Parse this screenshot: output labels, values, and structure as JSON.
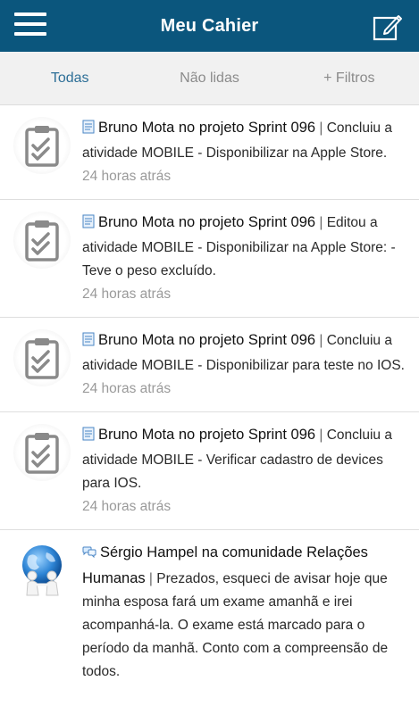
{
  "header": {
    "title": "Meu Cahier",
    "menu_icon": "hamburger-menu-icon",
    "compose_icon": "compose-edit-icon",
    "background": "#0b567d"
  },
  "tabs": [
    {
      "label": "Todas",
      "active": true
    },
    {
      "label": "Não lidas",
      "active": false
    },
    {
      "label": "+ Filtros",
      "active": false
    }
  ],
  "feed": [
    {
      "type_icon": "document-icon",
      "avatar": "clipboard-check-icon",
      "title": "Bruno Mota no projeto Sprint 096",
      "text": "Concluiu a atividade MOBILE - Disponibilizar na Apple Store.",
      "time": "24 horas atrás"
    },
    {
      "type_icon": "document-icon",
      "avatar": "clipboard-check-icon",
      "title": "Bruno Mota no projeto Sprint 096",
      "text": "Editou a atividade MOBILE - Disponibilizar na Apple Store: - Teve o peso excluído.",
      "time": "24 horas atrás"
    },
    {
      "type_icon": "document-icon",
      "avatar": "clipboard-check-icon",
      "title": "Bruno Mota no projeto Sprint 096",
      "text": "Concluiu a atividade MOBILE - Disponibilizar para teste no IOS.",
      "time": "24 horas atrás"
    },
    {
      "type_icon": "document-icon",
      "avatar": "clipboard-check-icon",
      "title": "Bruno Mota no projeto Sprint 096",
      "text": "Concluiu a atividade MOBILE - Verificar cadastro de devices para IOS.",
      "time": "24 horas atrás"
    },
    {
      "type_icon": "chat-bubbles-icon",
      "avatar": "globe-people-icon",
      "title": "Sérgio Hampel na comunidade Relações Humanas",
      "text": "Prezados, esqueci de avisar hoje que minha esposa fará um exame amanhã e irei acompanhá-la. O exame está marcado para o período da manhã. Conto com a compreensão de todos.",
      "time": ""
    }
  ]
}
